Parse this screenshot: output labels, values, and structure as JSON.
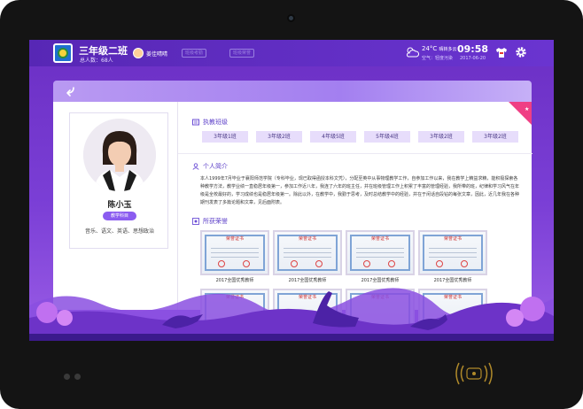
{
  "header": {
    "class_name": "三年级二班",
    "total_students": "总人数：68人",
    "teacher": "姜佳晴晴",
    "btn_1": "班级考勤",
    "btn_2": "班级荣誉",
    "temperature": "24°C",
    "weather": "晴转多云",
    "air_quality": "空气：轻度污染",
    "time": "09:58",
    "date": "2017-06-20"
  },
  "profile": {
    "name": "陈小玉",
    "badge": "教学科目",
    "subjects": "音乐、语文、英语、思想政治"
  },
  "sections": {
    "classes_title": "执教班级",
    "intro_title": "个人简介",
    "honors_title": "所获荣誉"
  },
  "classes": [
    "3年级1班",
    "3年级2班",
    "4年级5班",
    "5年级4班",
    "3年级2班",
    "3年级2班"
  ],
  "bio": "本人1999年7月毕业于襄阳师范学院（专科毕业，现已取得函授本科文凭），分配至英中从事物理教学工作，自参加工作以来，我在教学上精益求精，能积极探索各种教学方法，教学业绩一直稳居年级第一，参加工作近八年，我连了六年的班主任，并在班级管理工作上积累了丰富的管理经验，我所带的班，纪律和学习风气在年级是全校最好的，学习成绩也是稳居年级第一。除此以外，在教学中，我勤于思考，及时总结教学中的经验，并在于闲话自段钻的每张文章，因此，近几年我在各种期刊发表了多篇论题和文章，见后面附表。",
  "honors": [
    {
      "seal_text": "荣誉证书",
      "caption": "2017全国优秀教师"
    },
    {
      "seal_text": "荣誉证书",
      "caption": "2017全国优秀教师"
    },
    {
      "seal_text": "荣誉证书",
      "caption": "2017全国优秀教师"
    },
    {
      "seal_text": "荣誉证书",
      "caption": "2017全国优秀教师"
    },
    {
      "seal_text": "荣誉证书",
      "caption": ""
    },
    {
      "seal_text": "荣誉证书",
      "caption": ""
    },
    {
      "seal_text": "荣誉证书",
      "caption": ""
    },
    {
      "seal_text": "荣誉证书",
      "caption": ""
    }
  ]
}
